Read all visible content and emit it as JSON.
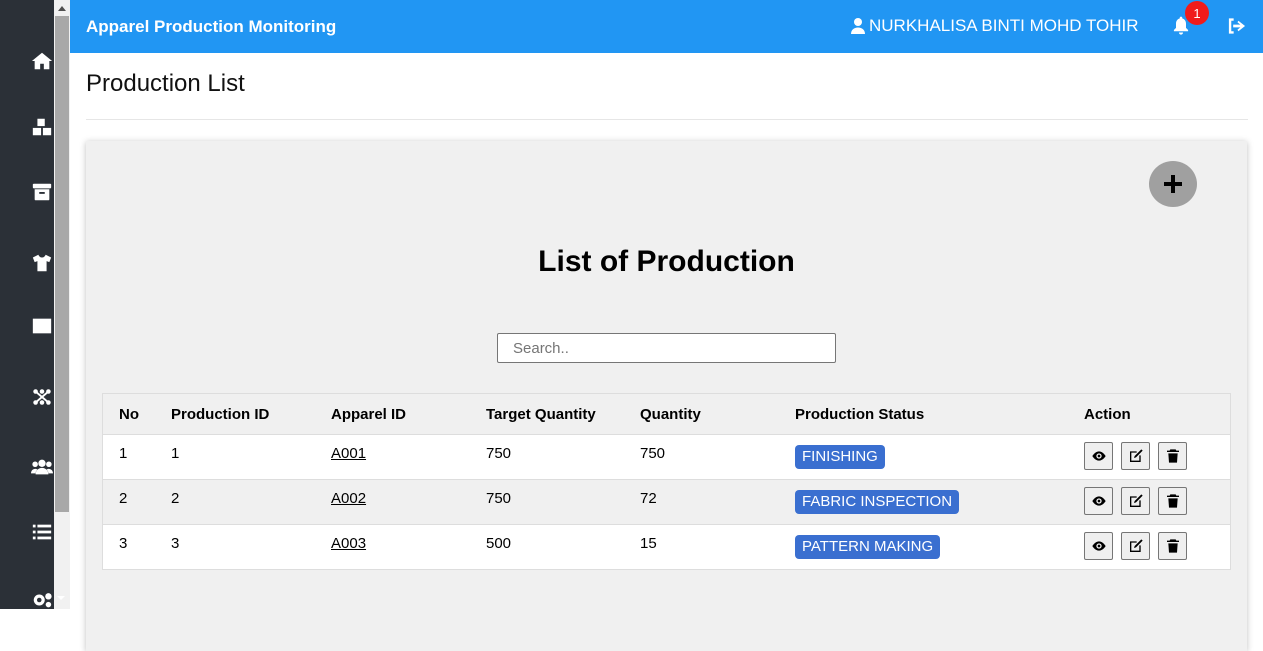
{
  "header": {
    "app_title": "Apparel Production Monitoring",
    "user_name": "NURKHALISA BINTI MOHD TOHIR",
    "notification_count": "1",
    "accent_color": "#2196f3"
  },
  "sidebar": {
    "items": [
      {
        "icon": "home-icon"
      },
      {
        "icon": "boxes-icon"
      },
      {
        "icon": "archive-icon"
      },
      {
        "icon": "shirt-icon"
      },
      {
        "icon": "square-icon"
      },
      {
        "icon": "network-icon"
      },
      {
        "icon": "users-icon"
      },
      {
        "icon": "list-icon"
      },
      {
        "icon": "settings-icon"
      }
    ]
  },
  "page": {
    "title": "Production List"
  },
  "card": {
    "title": "List of Production",
    "search_placeholder": "Search.."
  },
  "table": {
    "headers": [
      "No",
      "Production ID",
      "Apparel ID",
      "Target Quantity",
      "Quantity",
      "Production Status",
      "Action"
    ],
    "rows": [
      {
        "no": "1",
        "production_id": "1",
        "apparel_id": "A001",
        "target_quantity": "750",
        "quantity": "750",
        "status": "FINISHING"
      },
      {
        "no": "2",
        "production_id": "2",
        "apparel_id": "A002",
        "target_quantity": "750",
        "quantity": "72",
        "status": "FABRIC INSPECTION"
      },
      {
        "no": "3",
        "production_id": "3",
        "apparel_id": "A003",
        "target_quantity": "500",
        "quantity": "15",
        "status": "PATTERN MAKING"
      }
    ],
    "status_color": "#3a6fd0"
  }
}
